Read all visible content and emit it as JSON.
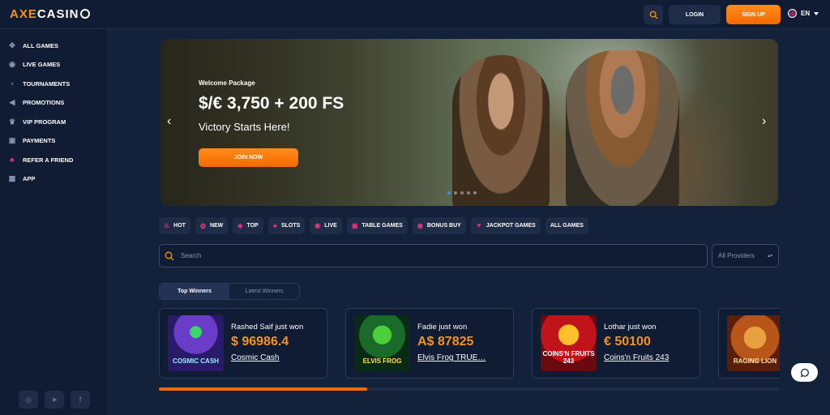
{
  "header": {
    "logo_axe": "AXE",
    "logo_casino": "CASIN",
    "login_label": "LOGIN",
    "signup_label": "SIGN UP",
    "language": "EN"
  },
  "sidebar": {
    "items": [
      {
        "label": "ALL GAMES",
        "icon": "dice-icon"
      },
      {
        "label": "LIVE GAMES",
        "icon": "live-icon"
      },
      {
        "label": "TOURNAMENTS",
        "icon": "trophy-icon"
      },
      {
        "label": "PROMOTIONS",
        "icon": "megaphone-icon"
      },
      {
        "label": "VIP PROGRAM",
        "icon": "crown-icon"
      },
      {
        "label": "PAYMENTS",
        "icon": "wallet-icon"
      },
      {
        "label": "REFER A FRIEND",
        "icon": "users-icon"
      },
      {
        "label": "APP",
        "icon": "app-grid-icon"
      }
    ],
    "socials": [
      "instagram-icon",
      "telegram-icon",
      "facebook-icon"
    ]
  },
  "banner": {
    "welcome": "Welcome Package",
    "headline": "$/€ 3,750 + 200 FS",
    "tagline": "Victory Starts Here!",
    "cta_label": "JOIN NOW",
    "slide_count": 5,
    "active_slide": 1
  },
  "categories": [
    {
      "label": "HOT",
      "icon": "flame-icon"
    },
    {
      "label": "NEW",
      "icon": "new-icon"
    },
    {
      "label": "TOP",
      "icon": "top-icon"
    },
    {
      "label": "SLOTS",
      "icon": "slots-icon"
    },
    {
      "label": "LIVE",
      "icon": "live-icon"
    },
    {
      "label": "TABLE GAMES",
      "icon": "table-icon"
    },
    {
      "label": "BONUS BUY",
      "icon": "bonus-icon"
    },
    {
      "label": "JACKPOT GAMES",
      "icon": "jackpot-icon"
    },
    {
      "label": "ALL GAMES",
      "icon": ""
    }
  ],
  "search": {
    "placeholder": "Search",
    "providers_label": "All Providers"
  },
  "winners": {
    "tabs": [
      "Top Winners",
      "Latest Winners"
    ],
    "cards": [
      {
        "name": "Rashed Saif just won",
        "amount": "$ 96986.4",
        "game": "Cosmic Cash",
        "thumb_text": "COSMIC CASH"
      },
      {
        "name": "Fadie just won",
        "amount": "A$ 87825",
        "game": "Elvis Frog TRUE…",
        "thumb_text": "ELVIS FROG"
      },
      {
        "name": "Lothar just won",
        "amount": "€ 50100",
        "game": "Coins'n Fruits 243",
        "thumb_text": "COINS'N FRUITS 243"
      },
      {
        "name": "",
        "amount": "",
        "game": "",
        "thumb_text": "RAGING LION"
      }
    ],
    "scroll_progress": 0.335
  },
  "colors": {
    "accent": "#f46a00",
    "amount": "#f7931a",
    "background": "#13213a",
    "panel": "#0f1c33"
  }
}
